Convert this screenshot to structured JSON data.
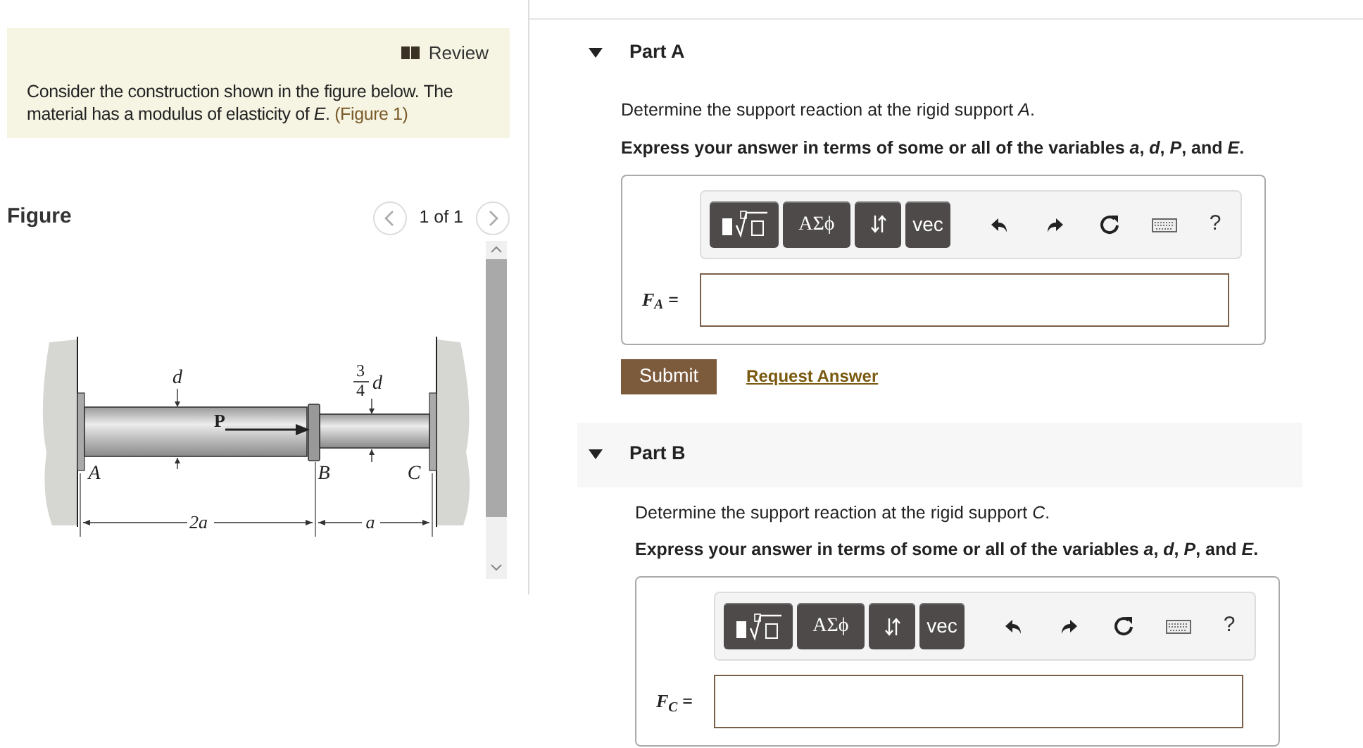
{
  "review": {
    "label": "Review"
  },
  "intro": {
    "text": "Consider the construction shown in the figure below. The material has a modulus of elasticity of *E*.",
    "link": "(Figure 1)"
  },
  "figure": {
    "title": "Figure",
    "pager": "1 of 1",
    "labels": [
      "d",
      "3",
      "4",
      "d",
      "P",
      "A",
      "B",
      "C",
      "2a",
      "a"
    ]
  },
  "parts": [
    {
      "title": "Part A",
      "expanded": true,
      "prompt": "Determine the support reaction at the rigid support *A*.",
      "instruction": "Express your answer in terms of some or all of the variables *a*, *d*, *P*, and *E*.",
      "answer_label": "*F*$_{A}$ =",
      "toolbar": [
        {
          "kind": "templates"
        },
        {
          "kind": "label",
          "label": "ΑΣϕ"
        },
        {
          "kind": "arrows"
        },
        {
          "kind": "label",
          "label": "vec"
        },
        {
          "kind": "undo"
        },
        {
          "kind": "redo"
        },
        {
          "kind": "reset"
        },
        {
          "kind": "keyboard"
        },
        {
          "kind": "help",
          "label": "?"
        }
      ],
      "submit": "Submit",
      "request": "Request Answer"
    },
    {
      "title": "Part B",
      "expanded": true,
      "prompt": "Determine the support reaction at the rigid support *C*.",
      "instruction": "Express your answer in terms of some or all of the variables *a*, *d*, *P*, and *E*.",
      "answer_label": "*F*$_{C}$ =",
      "toolbar": [
        {
          "kind": "templates"
        },
        {
          "kind": "label",
          "label": "ΑΣϕ"
        },
        {
          "kind": "arrows"
        },
        {
          "kind": "label",
          "label": "vec"
        },
        {
          "kind": "undo"
        },
        {
          "kind": "redo"
        },
        {
          "kind": "reset"
        },
        {
          "kind": "keyboard"
        },
        {
          "kind": "help",
          "label": "?"
        }
      ]
    }
  ]
}
